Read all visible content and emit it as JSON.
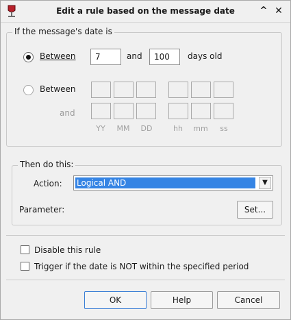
{
  "window": {
    "title": "Edit a rule based on the message date"
  },
  "date_group": {
    "legend": "If the message's date is",
    "age_option": {
      "label": "Between",
      "from": "7",
      "and_label": "and",
      "to": "100",
      "suffix": "days old",
      "selected": true
    },
    "range_option": {
      "label": "Between",
      "and_label": "and",
      "selected": false
    },
    "units": [
      "YY",
      "MM",
      "DD",
      "hh",
      "mm",
      "ss"
    ]
  },
  "action_group": {
    "legend": "Then do this:",
    "action_label": "Action:",
    "action_value": "Logical AND",
    "parameter_label": "Parameter:",
    "set_button": "Set..."
  },
  "options": {
    "disable_rule": "Disable this rule",
    "trigger_outside": "Trigger if the date is NOT within the specified period"
  },
  "buttons": {
    "ok": "OK",
    "help": "Help",
    "cancel": "Cancel"
  },
  "titlebar_buttons": {
    "shade": "^",
    "close": "✕"
  }
}
